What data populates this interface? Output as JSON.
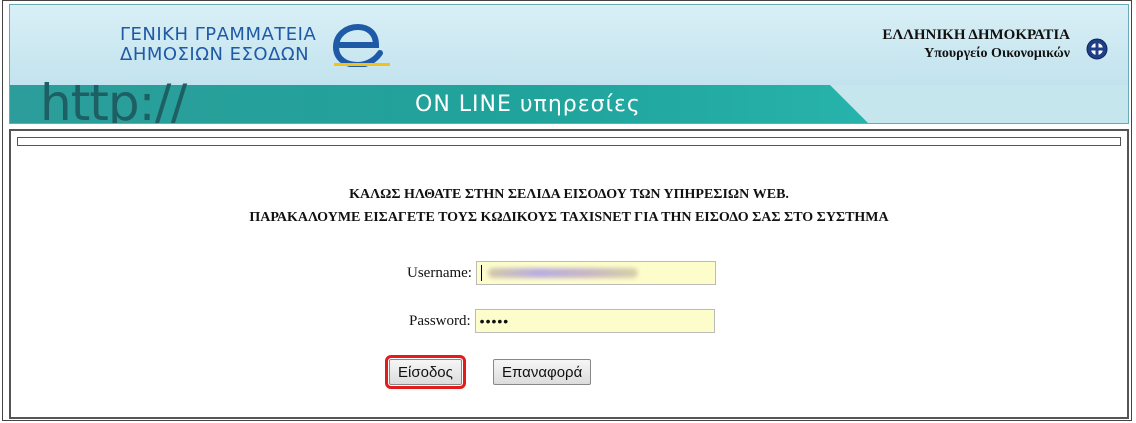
{
  "header": {
    "org_line1": "ΓΕΝΙΚΗ ΓΡΑΜΜΑΤΕΙΑ",
    "org_line2": "ΔΗΜΟΣΙΩΝ ΕΣΟΔΩΝ",
    "republic_line1": "ΕΛΛΗΝΙΚΗ ΔΗΜΟΚΡΑΤΙΑ",
    "republic_line2": "Υπουργείο Οικονομικών",
    "http_text": "http://",
    "online_text": "ON LINE υπηρεσίες",
    "colors": {
      "teal": "#1fa39b",
      "sky": "#c6e6ee",
      "brand_blue": "#1f5aa6"
    }
  },
  "welcome": {
    "line1": "ΚΑΛΩΣ ΗΛΘΑΤΕ ΣΤΗΝ ΣΕΛΙΔΑ ΕΙΣΟΔΟΥ ΤΩΝ ΥΠΗΡΕΣΙΩΝ WEB.",
    "line2": "ΠΑΡΑΚΑΛΟΥΜΕ ΕΙΣΑΓΕΤΕ ΤΟΥΣ ΚΩΔΙΚΟΥΣ TAXISNET ΓΙΑ ΤΗΝ ΕΙΣΟΔΟ ΣΑΣ ΣΤΟ ΣΥΣΤΗΜΑ"
  },
  "form": {
    "username_label": "Username:",
    "password_label": "Password:",
    "password_value": "•••••",
    "login_button": "Είσοδος",
    "reset_button": "Επαναφορά",
    "highlight_color": "#e31b1b"
  }
}
